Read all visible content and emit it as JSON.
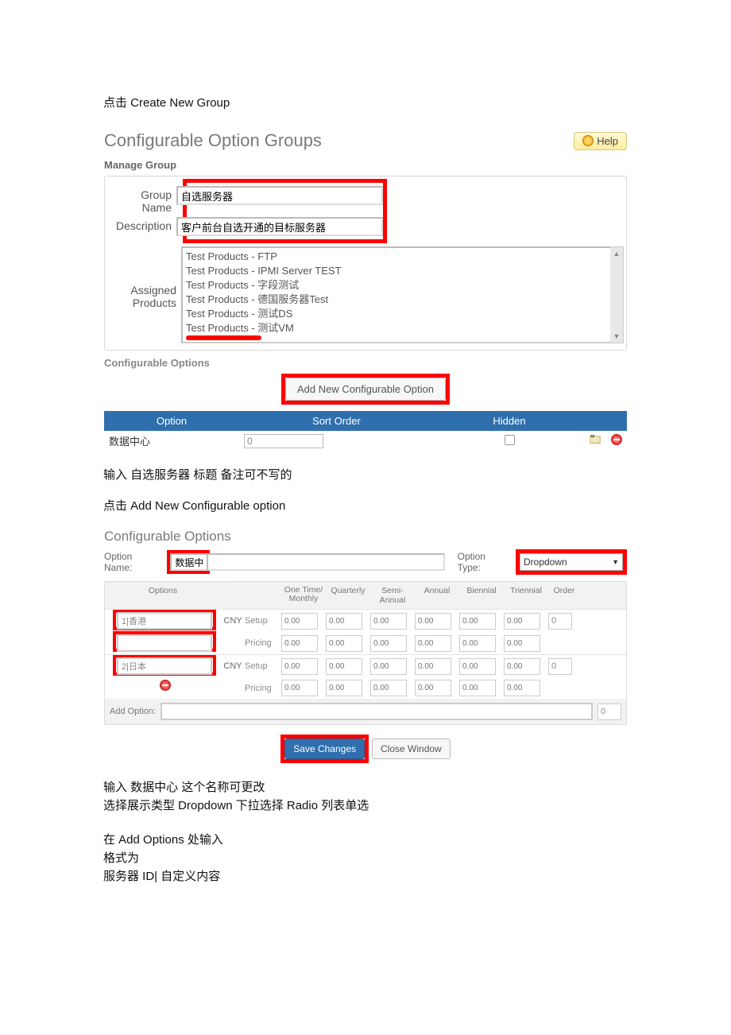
{
  "doc": {
    "line1": "点击 Create New Group",
    "line2": "输入 自选服务器 标题 备注可不写的",
    "line3": "点击 Add New Configurable option",
    "line4": "输入 数据中心 这个名称可更改",
    "line5": "选择展示类型 Dropdown 下拉选择 Radio 列表单选",
    "line6": "在 Add Options 处输入",
    "line7": "格式为",
    "line8": "服务器 ID| 自定义内容"
  },
  "s1": {
    "title": "Configurable Option Groups",
    "help_label": "Help",
    "manage_group": "Manage Group",
    "labels": {
      "group_name": "Group Name",
      "description": "Description",
      "assigned_products": "Assigned Products"
    },
    "values": {
      "group_name": "自选服务器",
      "description": "客户前台自选开通的目标服务器"
    },
    "products": [
      "Test Products - FTP",
      "Test Products - IPMI Server TEST",
      "Test Products - 字段测试",
      "Test Products - 德国服务器Test",
      "Test Products - 测试DS",
      "Test Products - 测试VM"
    ],
    "section_label": "Configurable Options",
    "add_btn": "Add New Configurable Option",
    "table": {
      "headers": {
        "option": "Option",
        "sort": "Sort Order",
        "hidden": "Hidden"
      },
      "row": {
        "option": "数据中心",
        "sort": "0"
      }
    }
  },
  "s2": {
    "title": "Configurable Options",
    "labels": {
      "option_name": "Option Name:",
      "option_type": "Option Type:",
      "add_option": "Add Option:"
    },
    "option_name_value": "数据中心",
    "option_type_value": "Dropdown",
    "grid_headers": {
      "options": "Options",
      "one_time": "One Time/ Monthly",
      "quarterly": "Quarterly",
      "semi_annual": "Semi-Annual",
      "annual": "Annual",
      "biennial": "Biennial",
      "triennial": "Triennial",
      "order": "Order"
    },
    "row_labels": {
      "setup": "Setup",
      "pricing": "Pricing"
    },
    "currency": "CNY",
    "price_placeholder": "0.00",
    "order_default": "0",
    "options": [
      {
        "value": "1|香港"
      },
      {
        "value": "2|日本"
      }
    ],
    "buttons": {
      "save": "Save Changes",
      "close": "Close Window"
    }
  }
}
